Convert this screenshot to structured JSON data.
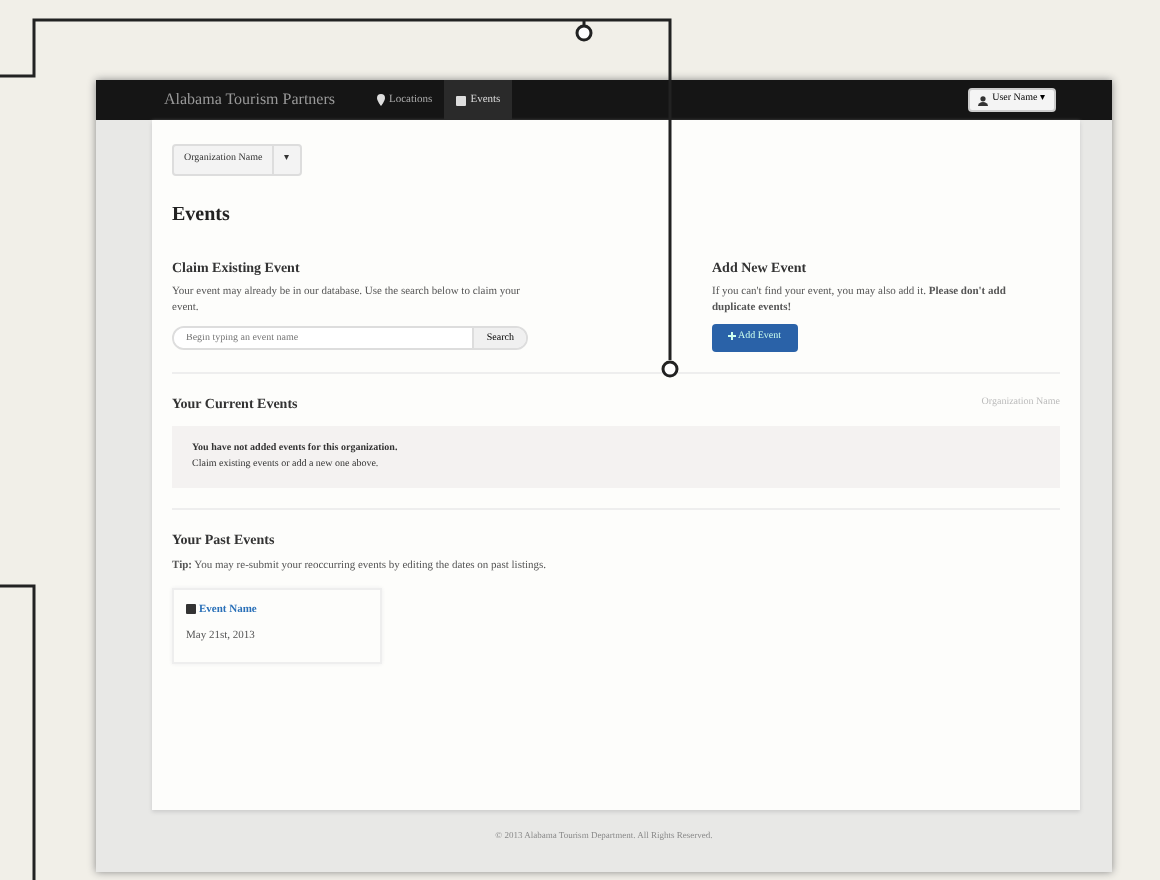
{
  "navbar": {
    "brand": "Alabama Tourism Partners",
    "links": [
      {
        "label": "Locations",
        "selected": false
      },
      {
        "label": "Events",
        "selected": true
      }
    ],
    "user_menu": "User Name",
    "user_menu_caret": "▾"
  },
  "org_selector": {
    "label": "Organization Name",
    "caret": "▾"
  },
  "page_title": "Events",
  "claim": {
    "heading": "Claim Existing Event",
    "text": "Your event may already be in our database. Use the search below to claim your event.",
    "search": {
      "placeholder": "Begin typing an event name"
    },
    "search_button": "Search"
  },
  "add": {
    "heading": "Add New Event",
    "text": "If you can't find your event, you may also add it. **Please don't add duplicate events!**",
    "button": "Add Event"
  },
  "current": {
    "heading": "Your Current Events",
    "org": "Organization Name",
    "empty_title": "You have not added events for this organization.",
    "empty_text": "Claim existing events or add a new one above."
  },
  "past": {
    "heading": "Your Past Events",
    "tip": "**Tip:** You may re-submit your reoccurring events by editing the dates on past listings.",
    "events": [
      {
        "name": "Event Name",
        "date": "May 21st, 2013"
      }
    ]
  },
  "footer": "© 2013 Alabama Tourism Department. All Rights Reserved."
}
